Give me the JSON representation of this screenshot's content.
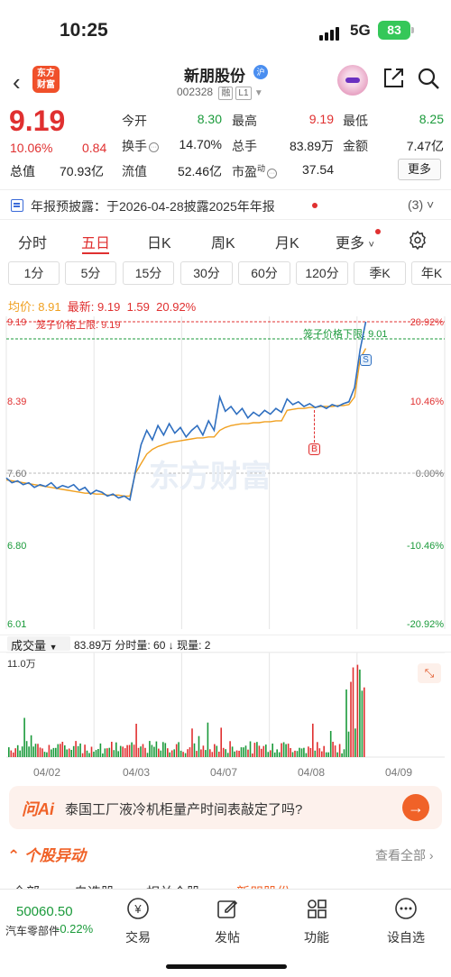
{
  "status_bar": {
    "time": "10:25",
    "network": "5G",
    "battery": "83"
  },
  "header": {
    "logo_line1": "东方",
    "logo_line2": "财富",
    "stock_name": "新朋股份",
    "badge": "沪",
    "code": "002328",
    "tag1": "融",
    "tag2": "L1"
  },
  "quote": {
    "price": "9.19",
    "change_pct": "10.06%",
    "change": "0.84",
    "mcap_label": "总值",
    "mcap": "70.93亿",
    "open_label": "今开",
    "open": "8.30",
    "high_label": "最高",
    "high": "9.19",
    "low_label": "最低",
    "low": "8.25",
    "turnover_label": "换手",
    "turnover": "14.70%",
    "volume_label": "总手",
    "volume": "83.89万",
    "amount_label": "金额",
    "amount": "7.47亿",
    "float_label": "流值",
    "float_cap": "52.46亿",
    "pe_label": "市盈",
    "pe_sup": "动",
    "pe": "37.54",
    "more": "更多"
  },
  "notice": {
    "text": "年报预披露：于2026-04-28披露2025年年报",
    "count": "(3)"
  },
  "tabs": [
    "分时",
    "五日",
    "日K",
    "周K",
    "月K",
    "更多"
  ],
  "interval_tabs": [
    "1分",
    "5分",
    "15分",
    "30分",
    "60分",
    "120分",
    "季K",
    "年K"
  ],
  "chart_info": {
    "avg_label": "均价:",
    "avg": "8.91",
    "last_label": "最新:",
    "last": "9.19",
    "chg": "1.59",
    "chg_pct": "20.92%",
    "upper_limit": "笼子价格上限: 9.19",
    "lower_limit": "笼子价格下限: 9.01",
    "marker_s": "S",
    "marker_b": "B",
    "watermark": "东方财富"
  },
  "chart_data": {
    "type": "line",
    "y_ticks": [
      "9.19",
      "8.39",
      "7.60",
      "6.80",
      "6.01"
    ],
    "y_pct_ticks": [
      "20.92%",
      "10.46%",
      "0.00%",
      "-10.46%",
      "-20.92%"
    ],
    "ylim": [
      6.01,
      9.19
    ],
    "x_labels": [
      "04/02",
      "04/03",
      "04/07",
      "04/08",
      "04/09"
    ],
    "series": [
      {
        "name": "最新",
        "color": "#2f6fc0",
        "values": [
          7.55,
          7.5,
          7.52,
          7.48,
          7.5,
          7.45,
          7.48,
          7.46,
          7.5,
          7.44,
          7.47,
          7.45,
          7.48,
          7.42,
          7.45,
          7.38,
          7.42,
          7.4,
          7.36,
          7.38,
          7.34,
          7.36,
          7.32,
          7.62,
          7.9,
          8.05,
          7.95,
          8.1,
          8.0,
          8.12,
          8.02,
          8.08,
          7.98,
          8.05,
          8.1,
          8.0,
          8.15,
          8.05,
          8.4,
          8.25,
          8.3,
          8.22,
          8.28,
          8.18,
          8.24,
          8.2,
          8.26,
          8.22,
          8.28,
          8.24,
          8.38,
          8.32,
          8.35,
          8.3,
          8.33,
          8.29,
          8.31,
          8.28,
          8.32,
          8.3,
          8.33,
          8.35,
          8.5,
          8.9,
          9.19
        ]
      },
      {
        "name": "均价",
        "color": "#f0a020",
        "values": [
          7.53,
          7.52,
          7.51,
          7.5,
          7.49,
          7.48,
          7.47,
          7.46,
          7.45,
          7.44,
          7.43,
          7.42,
          7.41,
          7.4,
          7.39,
          7.39,
          7.38,
          7.38,
          7.37,
          7.37,
          7.37,
          7.36,
          7.36,
          7.6,
          7.7,
          7.8,
          7.85,
          7.88,
          7.9,
          7.92,
          7.93,
          7.94,
          7.95,
          7.96,
          7.97,
          7.97,
          7.98,
          7.98,
          8.05,
          8.08,
          8.1,
          8.11,
          8.12,
          8.12,
          8.13,
          8.13,
          8.14,
          8.14,
          8.15,
          8.15,
          8.26,
          8.27,
          8.28,
          8.28,
          8.29,
          8.29,
          8.3,
          8.3,
          8.3,
          8.31,
          8.31,
          8.32,
          8.4,
          8.8,
          8.91
        ]
      }
    ],
    "volume": {
      "label": "成交量",
      "total": "83.89万",
      "per_label": "分时量: 60",
      "now_label": "现量: 2",
      "max_label": "11.0万"
    }
  },
  "ai": {
    "logo": "问Ai",
    "question": "泰国工厂液冷机柜量产时间表敲定了吗?"
  },
  "movers": {
    "title": "个股异动",
    "see_all": "查看全部"
  },
  "subtabs": [
    "全部",
    "自选股",
    "相关个股",
    "新朋股份"
  ],
  "bottom": {
    "index_value": "50060.50",
    "index_name": "汽车零部件",
    "index_pct": "-0.22%",
    "nav": [
      "交易",
      "发帖",
      "功能",
      "设自选"
    ]
  }
}
